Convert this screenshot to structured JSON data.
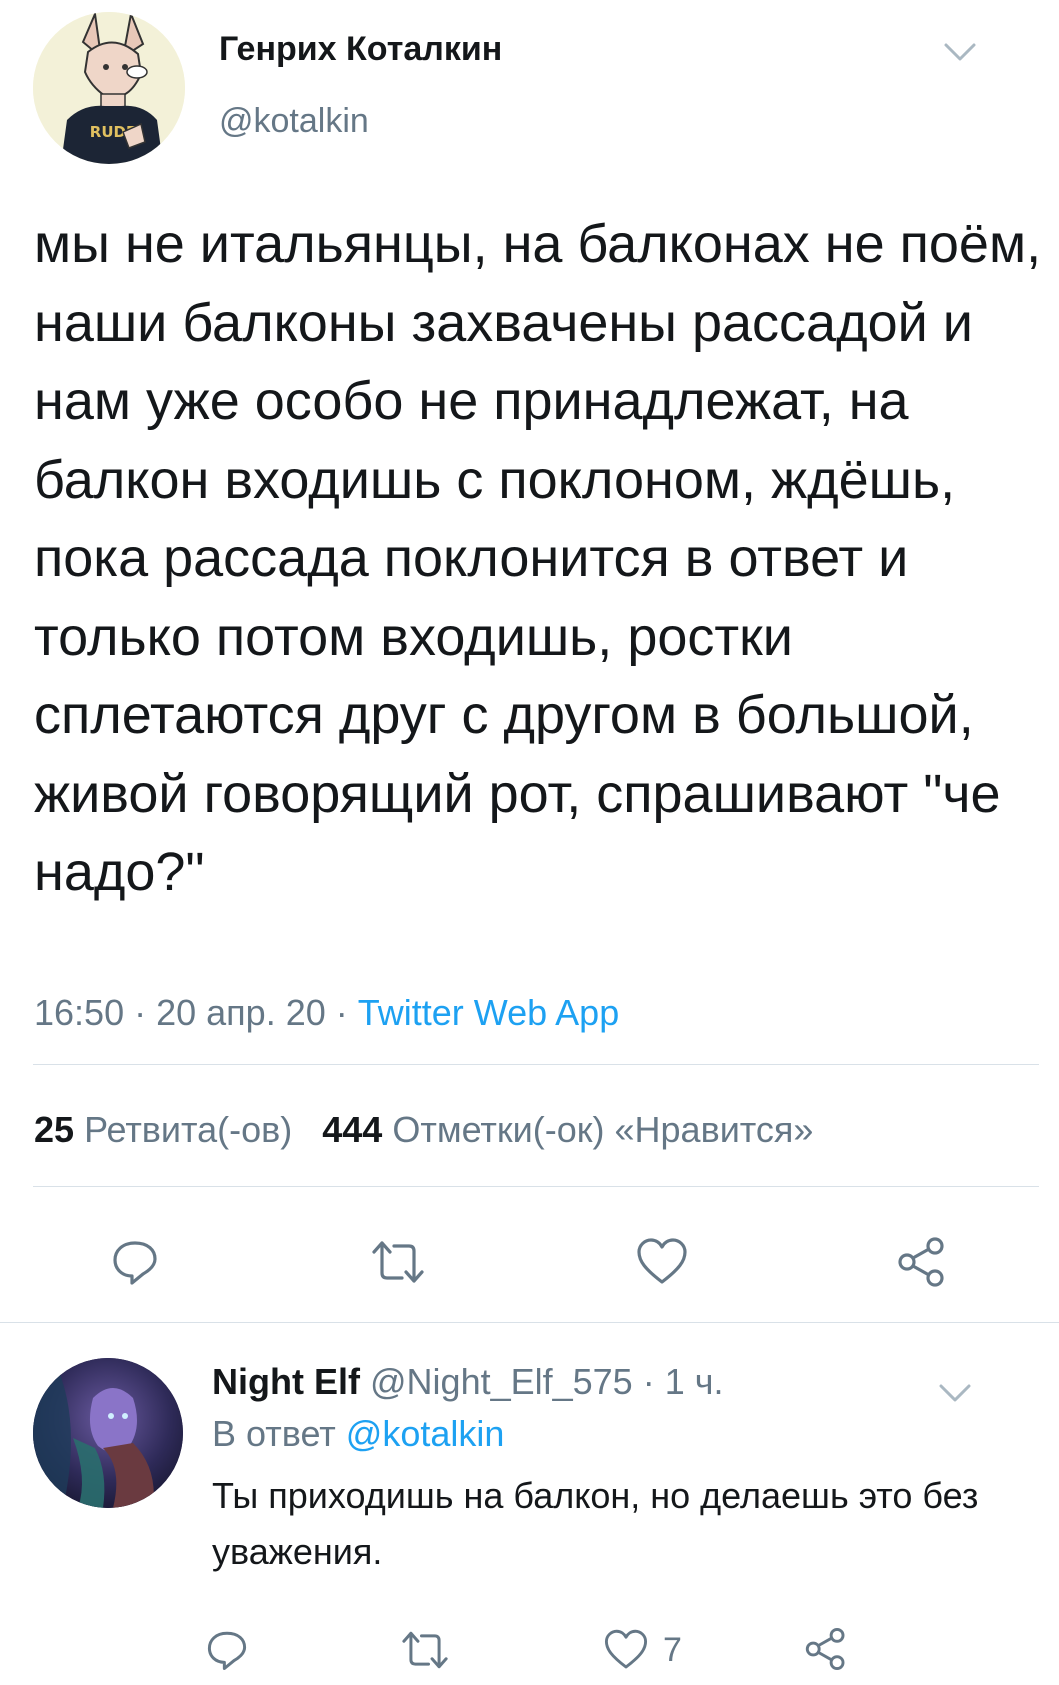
{
  "colors": {
    "text": "#14171a",
    "secondary": "#657786",
    "link": "#1da1f2",
    "divider": "#d9e1e8"
  },
  "tweet": {
    "author_name": "Генрих Коталкин",
    "author_handle": "@kotalkin",
    "avatar_shirt_text": "RUDE",
    "text": "мы не итальянцы, на балконах не поём, наши балконы захвачены рассадой и нам уже особо не принадлежат, на балкон входишь с поклоном, ждёшь, пока рассада поклонится в ответ и только потом входишь, ростки сплетаются друг с другом в большой, живой говорящий рот, спрашивают \"че надо?\"",
    "time": "16:50",
    "date": "20 апр. 20",
    "source": "Twitter Web App",
    "retweets_count": "25",
    "retweets_label": "Ретвита(-ов)",
    "likes_count": "444",
    "likes_label": "Отметки(-ок) «Нравится»",
    "actions": {
      "reply_icon": "reply-icon",
      "retweet_icon": "retweet-icon",
      "like_icon": "heart-icon",
      "share_icon": "share-icon"
    }
  },
  "reply": {
    "author_name": "Night Elf",
    "author_handle": "@Night_Elf_575",
    "age": "1 ч.",
    "reply_to_prefix": "В ответ",
    "reply_to_handle": "@kotalkin",
    "text": "Ты приходишь на балкон, но делаешь это без уважения.",
    "like_count": "7"
  }
}
